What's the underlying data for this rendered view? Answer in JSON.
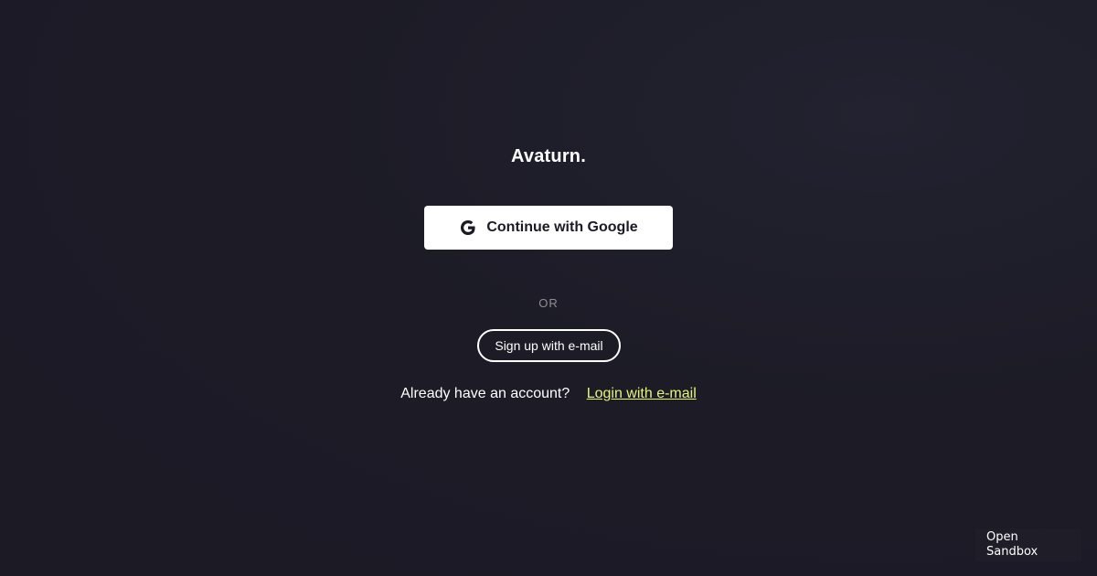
{
  "brand": {
    "logo_text": "Avaturn."
  },
  "auth": {
    "google_button_label": "Continue with Google",
    "google_icon": "google-icon",
    "divider_text": "OR",
    "signup_button_label": "Sign up with e-mail",
    "login_prompt": "Already have an account?",
    "login_link_label": "Login with e-mail"
  },
  "sandbox": {
    "line1": "Open",
    "line2": "Sandbox"
  },
  "colors": {
    "background": "#1c1b26",
    "link_accent": "#e6f57a",
    "divider_text": "#8f8e98"
  }
}
